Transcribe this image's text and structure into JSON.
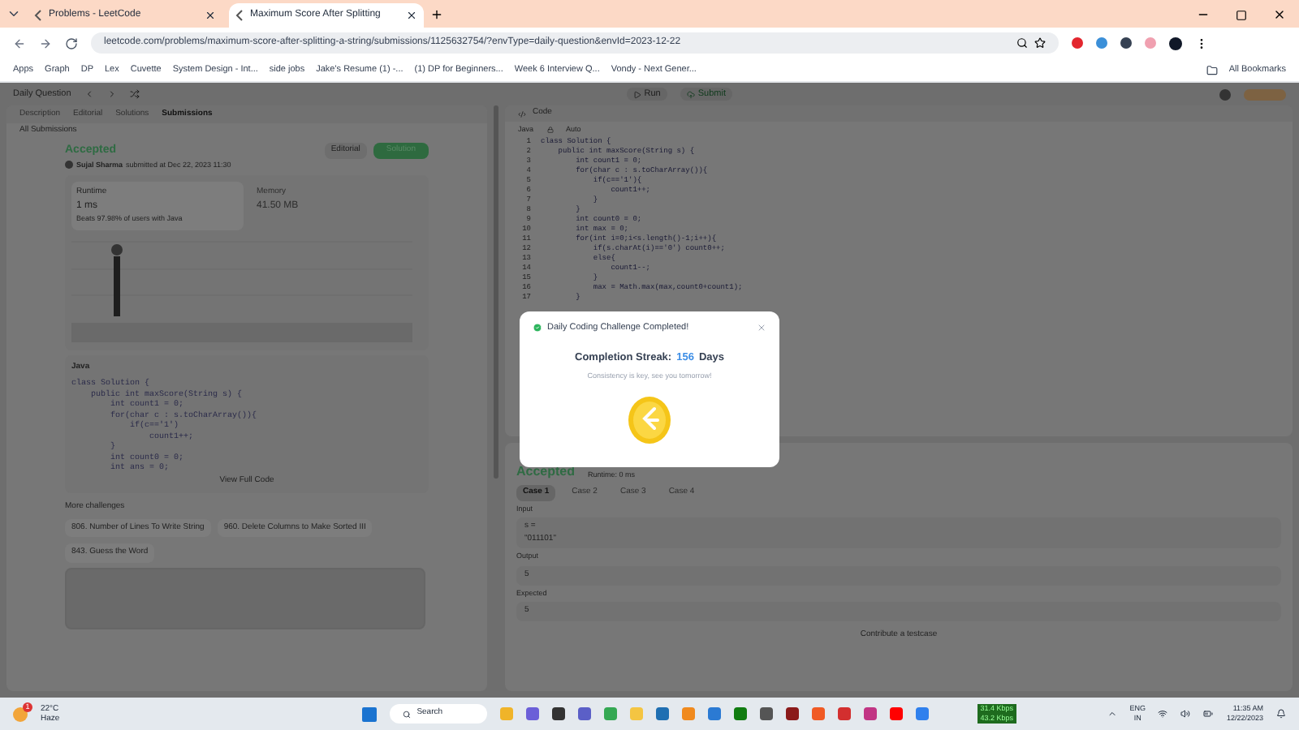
{
  "browser_tabs": [
    {
      "label": "Problems - LeetCode",
      "selected": false
    },
    {
      "label": "Maximum Score After Splitting",
      "selected": true
    }
  ],
  "address_bar": {
    "value": "leetcode.com/problems/maximum-score-after-splitting-a-string/submissions/1125632754/?envType=daily-question&envId=2023-12-22"
  },
  "bookmarks": [
    "Apps",
    "Graph",
    "DP",
    "Lex",
    "Cuvette",
    "System Design - Int...",
    "side jobs",
    "Jake's Resume (1) -...",
    "(1) DP for Beginners...",
    "Week 6 Interview Q...",
    "Vondy - Next Gener..."
  ],
  "all_bookmarks": "All Bookmarks",
  "topbar": {
    "title": "Daily Question",
    "run": "Run",
    "submit": "Submit"
  },
  "left_tabs": [
    {
      "label": "Description",
      "selected": false
    },
    {
      "label": "Editorial",
      "selected": false
    },
    {
      "label": "Solutions",
      "selected": false
    },
    {
      "label": "Submissions",
      "selected": true
    }
  ],
  "all_submissions": "All Submissions",
  "submission": {
    "status": "Accepted",
    "author": "Sujal Sharma",
    "submitted": "submitted at Dec 22, 2023 11:30",
    "editorial": "Editorial",
    "solution": "Solution",
    "runtime": {
      "label": "Runtime",
      "value": "1 ms",
      "beats": "Beats 97.98% of users with Java"
    },
    "memory": {
      "label": "Memory",
      "value": "41.50 MB"
    },
    "language": "Java",
    "code": [
      "class Solution {",
      "    public int maxScore(String s) {",
      "        int count1 = 0;",
      "        for(char c : s.toCharArray()){",
      "            if(c=='1')",
      "                count1++;",
      "        }",
      "        int count0 = 0;",
      "        int ans = 0;"
    ],
    "view_full": "View Full Code"
  },
  "more_challenges": {
    "title": "More challenges",
    "items": [
      "806. Number of Lines To Write String",
      "960. Delete Columns to Make Sorted III",
      "843. Guess the Word"
    ]
  },
  "editor": {
    "title": "Code",
    "language": "Java",
    "mode": "Auto",
    "lines": [
      {
        "number": "1",
        "text": "class Solution {"
      },
      {
        "number": "2",
        "text": "    public int maxScore(String s) {"
      },
      {
        "number": "3",
        "text": "        int count1 = 0;"
      },
      {
        "number": "4",
        "text": "        for(char c : s.toCharArray()){"
      },
      {
        "number": "5",
        "text": "            if(c=='1'){"
      },
      {
        "number": "6",
        "text": "                count1++;"
      },
      {
        "number": "7",
        "text": "            }"
      },
      {
        "number": "8",
        "text": "        }"
      },
      {
        "number": "9",
        "text": "        int count0 = 0;"
      },
      {
        "number": "10",
        "text": "        int max = 0;"
      },
      {
        "number": "11",
        "text": "        for(int i=0;i<s.length()-1;i++){"
      },
      {
        "number": "12",
        "text": "            if(s.charAt(i)=='0') count0++;"
      },
      {
        "number": "13",
        "text": "            else{"
      },
      {
        "number": "14",
        "text": "                count1--;"
      },
      {
        "number": "15",
        "text": "            }"
      },
      {
        "number": "16",
        "text": "            max = Math.max(max,count0+count1);"
      },
      {
        "number": "17",
        "text": "        }"
      }
    ]
  },
  "result": {
    "status": "Accepted",
    "runtime": "Runtime: 0 ms",
    "cases": [
      {
        "label": "Case 1",
        "selected": true
      },
      {
        "label": "Case 2",
        "selected": false
      },
      {
        "label": "Case 3",
        "selected": false
      },
      {
        "label": "Case 4",
        "selected": false
      }
    ],
    "input_label": "Input",
    "input_name": "s =",
    "input_value": "\"011101\"",
    "output_label": "Output",
    "output_value": "5",
    "expected_label": "Expected",
    "expected_value": "5",
    "contribute": "Contribute a testcase"
  },
  "modal": {
    "title": "Daily Coding Challenge Completed!",
    "streak_label": "Completion Streak:",
    "streak": "156",
    "days": "Days",
    "message": "Consistency is key, see you tomorrow!"
  },
  "taskbar": {
    "weather_badge": "1",
    "temperature": "22°C",
    "weather": "Haze",
    "search": "Search",
    "upload": "31.4 Kbps",
    "download": "43.2 Kbps",
    "lang": "ENG",
    "region": "IN",
    "time": "11:35 AM",
    "date": "12/22/2023"
  }
}
